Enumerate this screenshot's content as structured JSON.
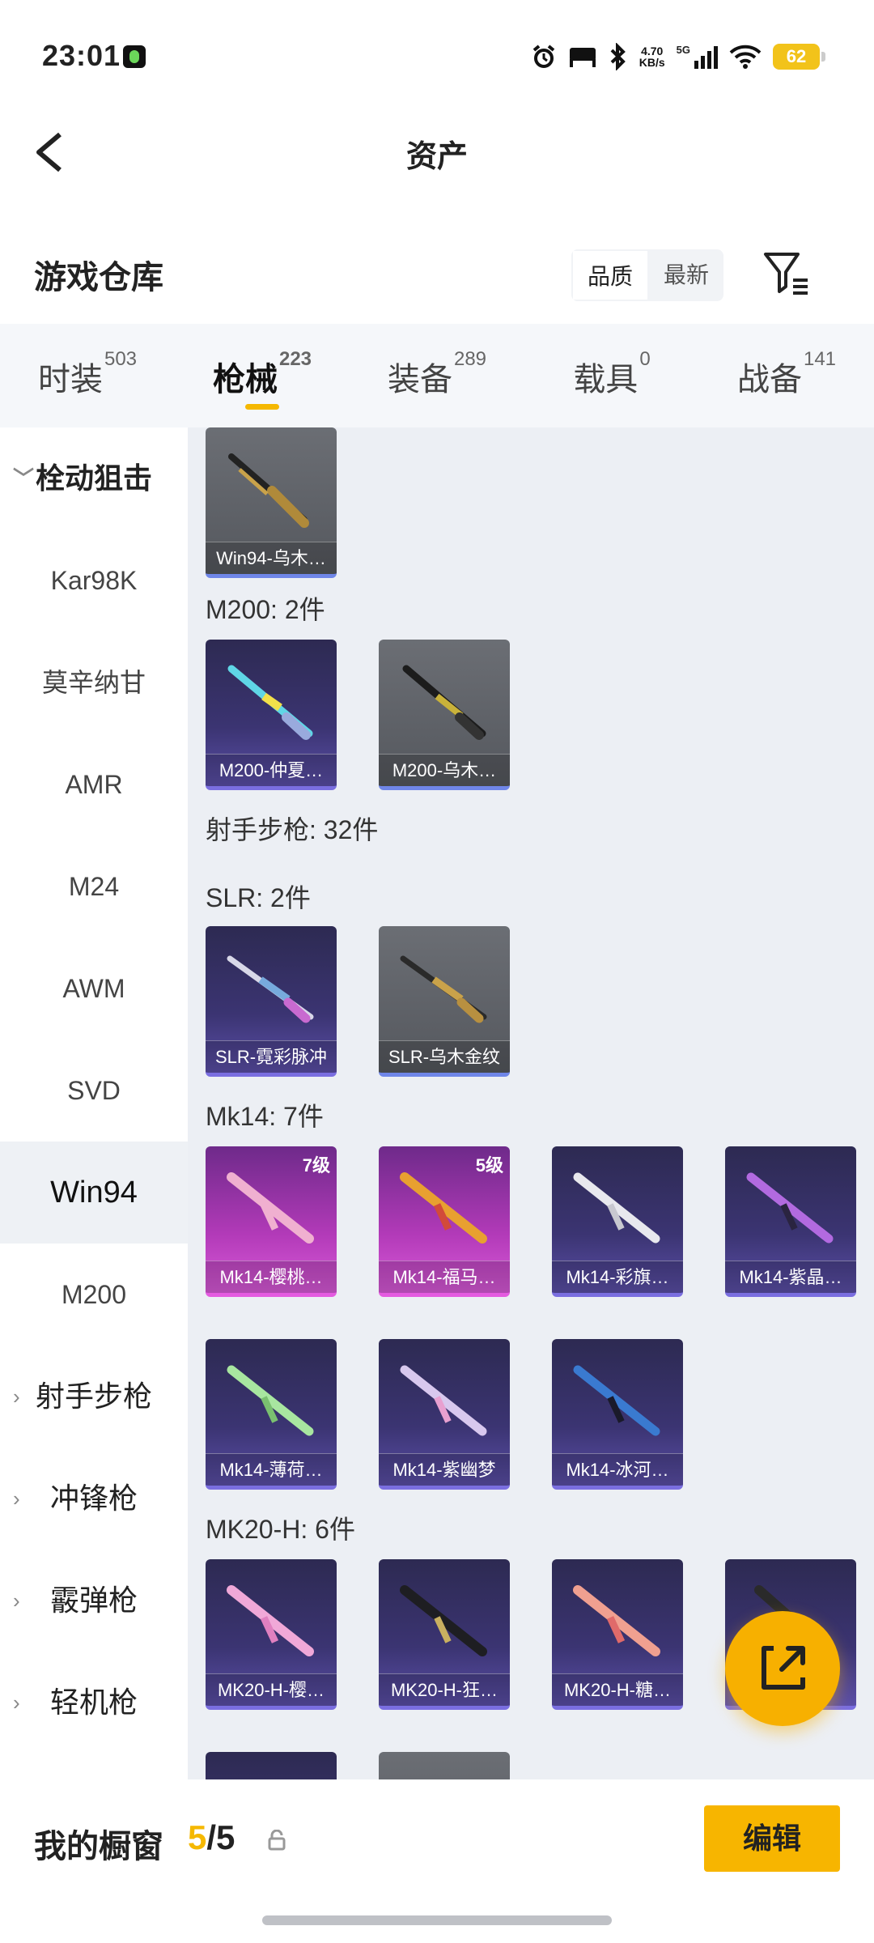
{
  "status_bar": {
    "time": "23:01",
    "net_speed": "4.70",
    "net_unit": "KB/s",
    "net_type": "5G",
    "battery": "62"
  },
  "header": {
    "title": "资产"
  },
  "warehouse": {
    "title": "游戏仓库",
    "sort_quality": "品质",
    "sort_newest": "最新"
  },
  "tabs": [
    {
      "label": "时装",
      "count": "503"
    },
    {
      "label": "枪械",
      "count": "223"
    },
    {
      "label": "装备",
      "count": "289"
    },
    {
      "label": "载具",
      "count": "0"
    },
    {
      "label": "战备",
      "count": "141"
    }
  ],
  "sidebar": {
    "group_open": "栓动狙击",
    "items": [
      "Kar98K",
      "莫辛纳甘",
      "AMR",
      "M24",
      "AWM",
      "SVD",
      "Win94",
      "M200"
    ],
    "groups": [
      "射手步枪",
      "冲锋枪",
      "霰弹枪",
      "轻机枪"
    ]
  },
  "sections": {
    "m200": "M200: 2件",
    "marksman": "射手步枪: 32件",
    "slr": "SLR: 2件",
    "mk14": "Mk14: 7件",
    "mk20": "MK20-H: 6件"
  },
  "cards": {
    "win94": [
      "Win94-乌木…"
    ],
    "m200": [
      "M200-仲夏…",
      "M200-乌木…"
    ],
    "slr": [
      "SLR-霓彩脉冲",
      "SLR-乌木金纹"
    ],
    "mk14": [
      "Mk14-樱桃…",
      "Mk14-福马…",
      "Mk14-彩旗…",
      "Mk14-紫晶…",
      "Mk14-薄荷…",
      "Mk14-紫幽梦",
      "Mk14-冰河…"
    ],
    "mk14_levels": [
      "7级",
      "5级"
    ],
    "mk20": [
      "MK20-H-樱…",
      "MK20-H-狂…",
      "MK20-H-糖…"
    ]
  },
  "bottom": {
    "label": "我的橱窗",
    "count_current": "5",
    "count_sep": "/",
    "count_total": "5",
    "edit": "编辑"
  },
  "colors": {
    "accent": "#f5b800",
    "card_gray": "#5e6167",
    "card_purple": "#3b3472",
    "card_pink": "#b23ab8"
  }
}
